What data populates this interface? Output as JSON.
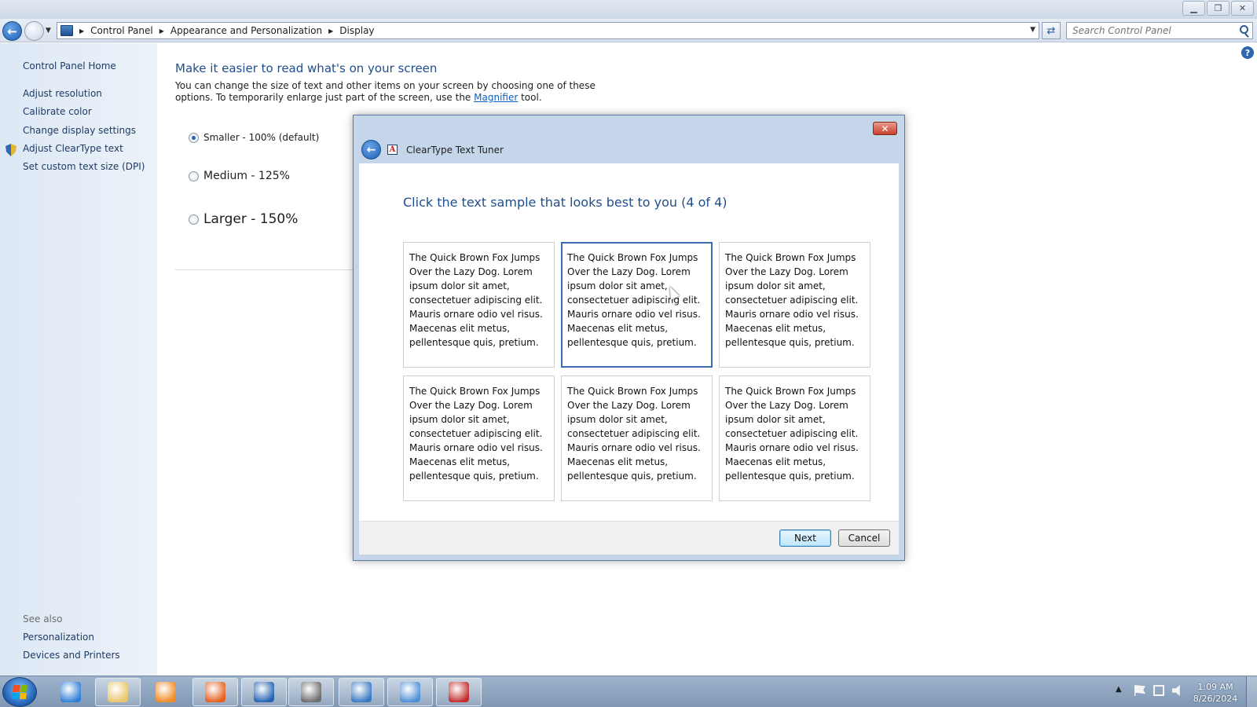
{
  "window": {
    "controls": {
      "minimize": "▁",
      "maximize": "❐",
      "close": "✕"
    }
  },
  "breadcrumb": [
    "Control Panel",
    "Appearance and Personalization",
    "Display"
  ],
  "search": {
    "placeholder": "Search Control Panel"
  },
  "sidebar": {
    "home": "Control Panel Home",
    "items": [
      {
        "label": "Adjust resolution"
      },
      {
        "label": "Calibrate color"
      },
      {
        "label": "Change display settings"
      },
      {
        "label": "Adjust ClearType text"
      },
      {
        "label": "Set custom text size (DPI)"
      }
    ],
    "see_also_label": "See also",
    "see_also": [
      {
        "label": "Personalization"
      },
      {
        "label": "Devices and Printers"
      }
    ]
  },
  "main": {
    "title": "Make it easier to read what's on your screen",
    "desc_before": "You can change the size of text and other items on your screen by choosing one of these options. To temporarily enlarge just part of the screen, use the ",
    "desc_link": "Magnifier",
    "desc_after": " tool.",
    "options": [
      {
        "label": "Smaller - 100% (default)",
        "selected": true
      },
      {
        "label": "Medium - 125%",
        "selected": false
      },
      {
        "label": "Larger - 150%",
        "selected": false
      }
    ]
  },
  "dialog": {
    "title": "ClearType Text Tuner",
    "close": "✕",
    "heading": "Click the text sample that looks best to you (4 of 4)",
    "sample_text": "The Quick Brown Fox Jumps Over the Lazy Dog. Lorem ipsum dolor sit amet, consectetuer adipiscing elit. Mauris ornare odio vel risus. Maecenas elit metus, pellentesque quis, pretium.",
    "selected_sample": 2,
    "buttons": {
      "next": "Next",
      "cancel": "Cancel"
    }
  },
  "taskbar": {
    "apps": [
      {
        "name": "internet-explorer-icon",
        "color": "#2f7fd8"
      },
      {
        "name": "file-explorer-icon",
        "color": "#e9c66a"
      },
      {
        "name": "media-player-icon",
        "color": "#f08a24"
      },
      {
        "name": "firefox-icon",
        "color": "#e5601e"
      },
      {
        "name": "app-icon",
        "color": "#2563b3"
      },
      {
        "name": "photo-icon",
        "color": "#6d6d6d"
      },
      {
        "name": "display-settings-icon",
        "color": "#3a7ac4"
      },
      {
        "name": "control-panel-icon",
        "color": "#4e8fd6"
      },
      {
        "name": "cleartype-icon",
        "color": "#c22d2d"
      }
    ],
    "clock": {
      "time": "1:09 AM",
      "date": "8/26/2024"
    }
  }
}
